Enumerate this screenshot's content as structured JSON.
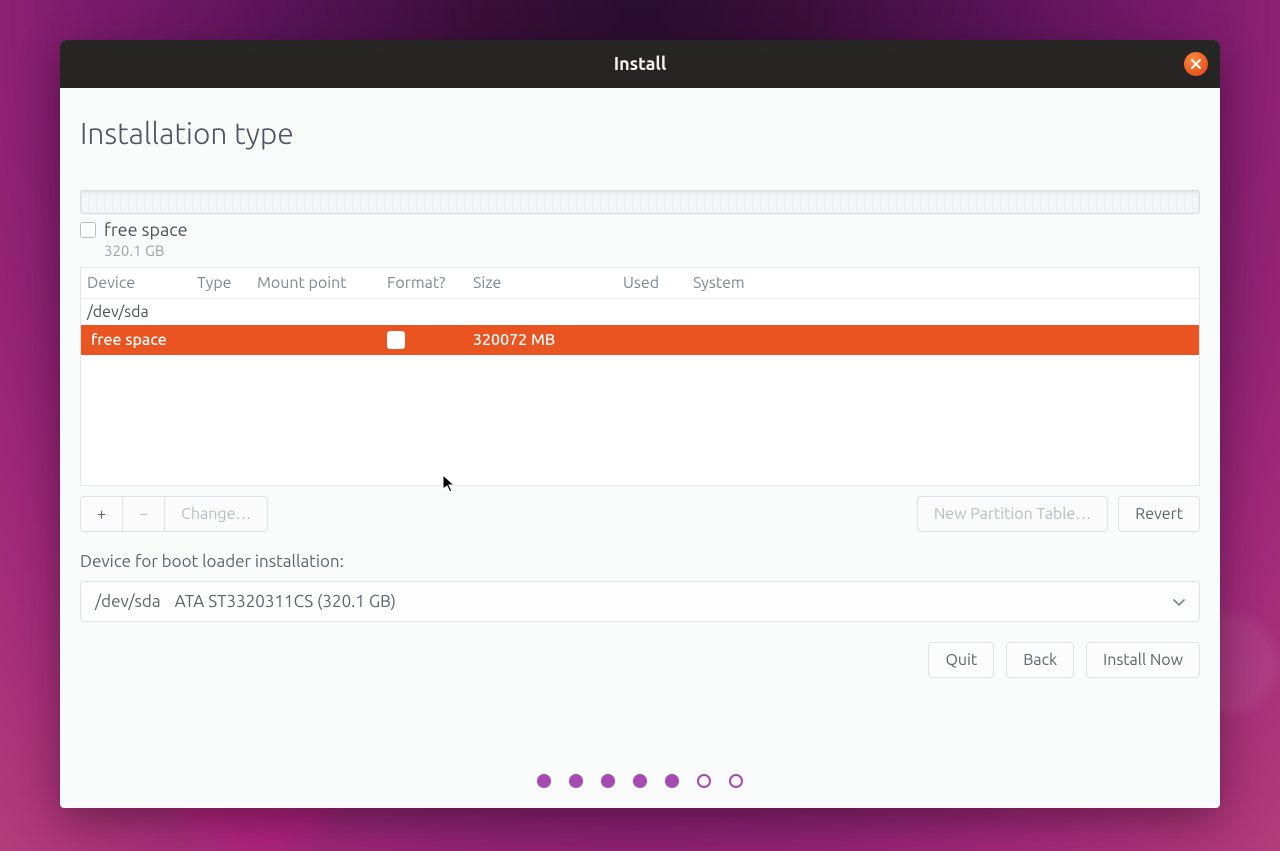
{
  "window": {
    "title": "Install"
  },
  "page": {
    "heading": "Installation type"
  },
  "legend": {
    "label": "free space",
    "size": "320.1 GB"
  },
  "columns": {
    "device": "Device",
    "type": "Type",
    "mount": "Mount point",
    "format": "Format?",
    "size": "Size",
    "used": "Used",
    "system": "System"
  },
  "disk": {
    "name": "/dev/sda"
  },
  "rows": [
    {
      "device": "free space",
      "type": "",
      "mount": "",
      "format_checked": false,
      "size": "320072 MB",
      "used": "",
      "system": "",
      "selected": true
    }
  ],
  "toolbar": {
    "add": "+",
    "remove": "−",
    "change": "Change…",
    "new_table": "New Partition Table…",
    "revert": "Revert"
  },
  "boot": {
    "label": "Device for boot loader installation:",
    "device": "/dev/sda",
    "desc": "ATA ST3320311CS (320.1 GB)"
  },
  "nav": {
    "quit": "Quit",
    "back": "Back",
    "install": "Install Now"
  },
  "progress": {
    "filled": 5,
    "total": 7
  }
}
